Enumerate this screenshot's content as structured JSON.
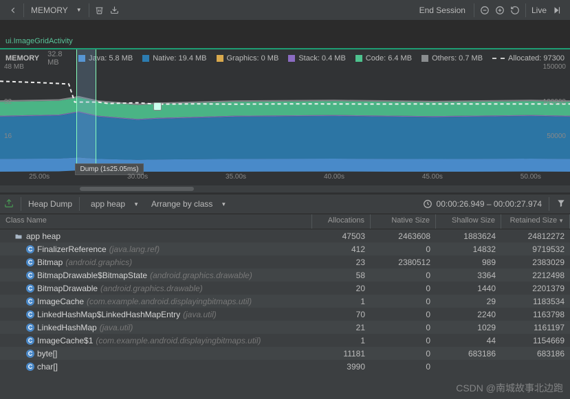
{
  "toolbar": {
    "memory_label": "MEMORY",
    "end_session": "End Session",
    "live": "Live"
  },
  "activity": "ui.ImageGridActivity",
  "legend": {
    "title": "MEMORY",
    "total": "32.8 MB",
    "items": [
      {
        "label": "Java: 5.8 MB",
        "color": "#4d93d9"
      },
      {
        "label": "Native: 19.4 MB",
        "color": "#2c7cb0"
      },
      {
        "label": "Graphics: 0 MB",
        "color": "#d9a94d"
      },
      {
        "label": "Stack: 0.4 MB",
        "color": "#8b6bc2"
      },
      {
        "label": "Code: 6.4 MB",
        "color": "#4ec28e"
      },
      {
        "label": "Others: 0.7 MB",
        "color": "#8a8d8f"
      }
    ],
    "allocated": "Allocated: 97300"
  },
  "chart_data": {
    "type": "area",
    "x_range": [
      23,
      52
    ],
    "x_ticks": [
      "25.00s",
      "30.00s",
      "35.00s",
      "40.00s",
      "45.00s",
      "50.00s"
    ],
    "x_tick_positions": [
      25,
      30,
      35,
      40,
      45,
      50
    ],
    "y_left_ticks": [
      {
        "v": 48,
        "label": "48 MB"
      },
      {
        "v": 32,
        "label": "32"
      },
      {
        "v": 16,
        "label": "16"
      }
    ],
    "y_right_ticks": [
      {
        "v": 150000,
        "label": "150000"
      },
      {
        "v": 100000,
        "label": "100000"
      },
      {
        "v": 50000,
        "label": "50000"
      }
    ],
    "y_left_max": 48,
    "y_right_max": 150000,
    "series": [
      {
        "name": "Others",
        "color": "#8a8d8f",
        "base": 32.1,
        "extra": [
          [
            23,
            0.7
          ],
          [
            52,
            0.7
          ]
        ]
      },
      {
        "name": "Code",
        "color": "#4ec28e",
        "base": 25.6,
        "extra": [
          [
            23,
            6.4
          ],
          [
            52,
            6.4
          ]
        ]
      },
      {
        "name": "Stack",
        "color": "#8b6bc2",
        "base": 25.2,
        "extra": [
          [
            23,
            0.4
          ],
          [
            52,
            0.4
          ]
        ]
      },
      {
        "name": "Graphics",
        "color": "#d9a94d",
        "base": 25.2,
        "extra": [
          [
            23,
            0
          ],
          [
            52,
            0
          ]
        ]
      },
      {
        "name": "Native",
        "color": "#2c7cb0",
        "base": 5.8,
        "extra": [
          [
            23,
            19.4
          ],
          [
            52,
            19.4
          ]
        ]
      },
      {
        "name": "Java",
        "color": "#4d93d9",
        "base": 0,
        "extra": [
          [
            23,
            5.8
          ],
          [
            52,
            5.8
          ]
        ]
      }
    ],
    "allocated_line": [
      [
        23,
        130000
      ],
      [
        25,
        128000
      ],
      [
        26.5,
        126000
      ],
      [
        26.8,
        100000
      ],
      [
        28,
        100000
      ],
      [
        28.5,
        98000
      ],
      [
        30,
        99000
      ],
      [
        31,
        97000
      ],
      [
        33,
        97500
      ],
      [
        35,
        97000
      ],
      [
        38,
        97500
      ],
      [
        42,
        97200
      ],
      [
        46,
        97400
      ],
      [
        50,
        97300
      ],
      [
        52,
        97300
      ]
    ],
    "selection": {
      "start": 26.9,
      "end": 27.9
    },
    "dump_tooltip": "Dump (1s25.05ms)",
    "marker_x": 31
  },
  "heap": {
    "dump_label": "Heap Dump",
    "scope": "app heap",
    "arrange": "Arrange by class",
    "time_range": "00:00:26.949 – 00:00:27.974",
    "headers": [
      "Class Name",
      "Allocations",
      "Native Size",
      "Shallow Size",
      "Retained Size"
    ],
    "rows": [
      {
        "type": "heap",
        "indent": 0,
        "name": "app heap",
        "pkg": "",
        "alloc": 47503,
        "native": 2463608,
        "shallow": 1883624,
        "retained": 24812272
      },
      {
        "type": "class",
        "indent": 1,
        "name": "FinalizerReference",
        "pkg": "(java.lang.ref)",
        "alloc": 412,
        "native": 0,
        "shallow": 14832,
        "retained": 9719532
      },
      {
        "type": "class",
        "indent": 1,
        "name": "Bitmap",
        "pkg": "(android.graphics)",
        "alloc": 23,
        "native": 2380512,
        "shallow": 989,
        "retained": 2383029
      },
      {
        "type": "class",
        "indent": 1,
        "name": "BitmapDrawable$BitmapState",
        "pkg": "(android.graphics.drawable)",
        "alloc": 58,
        "native": 0,
        "shallow": 3364,
        "retained": 2212498
      },
      {
        "type": "class",
        "indent": 1,
        "name": "BitmapDrawable",
        "pkg": "(android.graphics.drawable)",
        "alloc": 20,
        "native": 0,
        "shallow": 1440,
        "retained": 2201379
      },
      {
        "type": "class",
        "indent": 1,
        "name": "ImageCache",
        "pkg": "(com.example.android.displayingbitmaps.util)",
        "alloc": 1,
        "native": 0,
        "shallow": 29,
        "retained": 1183534
      },
      {
        "type": "class",
        "indent": 1,
        "name": "LinkedHashMap$LinkedHashMapEntry",
        "pkg": "(java.util)",
        "alloc": 70,
        "native": 0,
        "shallow": 2240,
        "retained": 1163798
      },
      {
        "type": "class",
        "indent": 1,
        "name": "LinkedHashMap",
        "pkg": "(java.util)",
        "alloc": 21,
        "native": 0,
        "shallow": 1029,
        "retained": 1161197
      },
      {
        "type": "class",
        "indent": 1,
        "name": "ImageCache$1",
        "pkg": "(com.example.android.displayingbitmaps.util)",
        "alloc": 1,
        "native": 0,
        "shallow": 44,
        "retained": 1154669
      },
      {
        "type": "class",
        "indent": 1,
        "name": "byte[]",
        "pkg": "",
        "alloc": 11181,
        "native": 0,
        "shallow": 683186,
        "retained": 683186
      },
      {
        "type": "class",
        "indent": 1,
        "name": "char[]",
        "pkg": "",
        "alloc": 3990,
        "native": 0,
        "shallow": "",
        "retained": ""
      }
    ]
  },
  "watermark": "CSDN @南城故事北边跑"
}
